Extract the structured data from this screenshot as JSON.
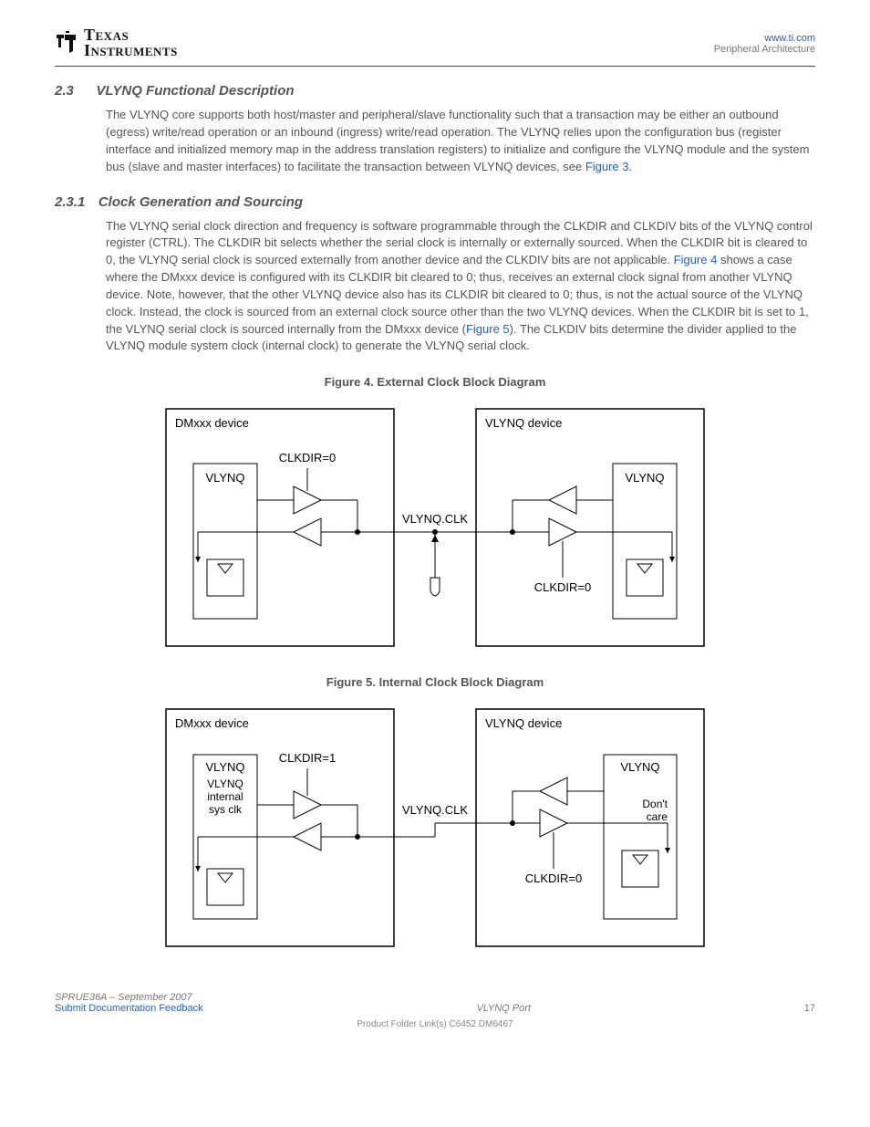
{
  "header": {
    "brand_top": "Texas",
    "brand_bottom": "Instruments",
    "right_link": "www.ti.com",
    "right_text": "Peripheral Architecture"
  },
  "section": {
    "number": "2.3",
    "title": "VLYNQ Functional Description",
    "para1_pre": "The VLYNQ core supports both host/master and peripheral/slave functionality such that a transaction may be either an outbound (egress) write/read operation or an inbound (ingress) write/read operation. The VLYNQ relies upon the configuration bus (register interface and initialized memory map in the address translation registers) to initialize and configure the VLYNQ module and the system bus (slave and master interfaces) to facilitate the transaction between VLYNQ devices, see ",
    "para1_link": "Figure 3",
    "para1_post": "."
  },
  "subsection": {
    "number": "2.3.1",
    "title": "Clock Generation and Sourcing",
    "para_pre": "The VLYNQ serial clock direction and frequency is software programmable through the CLKDIR and CLKDIV bits of the VLYNQ control register (CTRL). The CLKDIR bit selects whether the serial clock is internally or externally sourced. When the CLKDIR bit is cleared to 0, the VLYNQ serial clock is sourced externally from another device and the CLKDIV bits are not applicable. ",
    "para_link1": "Figure 4",
    "para_mid": " shows a case where the DMxxx device is configured with its CLKDIR bit cleared to 0; thus, receives an external clock signal from another VLYNQ device. Note, however, that the other VLYNQ device also has its CLKDIR bit cleared to 0; thus, is not the actual source of the VLYNQ clock. Instead, the clock is sourced from an external clock source other than the two VLYNQ devices. When the CLKDIR bit is set to 1, the VLYNQ serial clock is sourced internally from the DMxxx device (",
    "para_link2": "Figure 5",
    "para_post": "). The CLKDIV bits determine the divider applied to the VLYNQ module system clock (internal clock) to generate the VLYNQ serial clock."
  },
  "fig4": {
    "caption": "Figure 4. External Clock Block Diagram",
    "left_box": "DMxxx device",
    "right_box": "VLYNQ device",
    "vlynq": "VLYNQ",
    "clkdir_l": "CLKDIR=0",
    "clkdir_r": "CLKDIR=0",
    "wire": "VLYNQ.CLK"
  },
  "fig5": {
    "caption": "Figure 5. Internal Clock Block Diagram",
    "left_box": "DMxxx device",
    "right_box": "VLYNQ device",
    "vlynq": "VLYNQ",
    "sub1": "VLYNQ",
    "sub2": "internal",
    "sub3": "sys clk",
    "clkdir_l": "CLKDIR=1",
    "clkdir_r": "CLKDIR=0",
    "wire": "VLYNQ.CLK",
    "dontcare1": "Don't",
    "dontcare2": "care"
  },
  "footer": {
    "left_pre": "SPRUE36A – September 2007",
    "left_link": "Submit Documentation Feedback",
    "center": "VLYNQ Port",
    "right": "17",
    "bottom": "Product Folder Link(s) C6452 DM6467"
  }
}
